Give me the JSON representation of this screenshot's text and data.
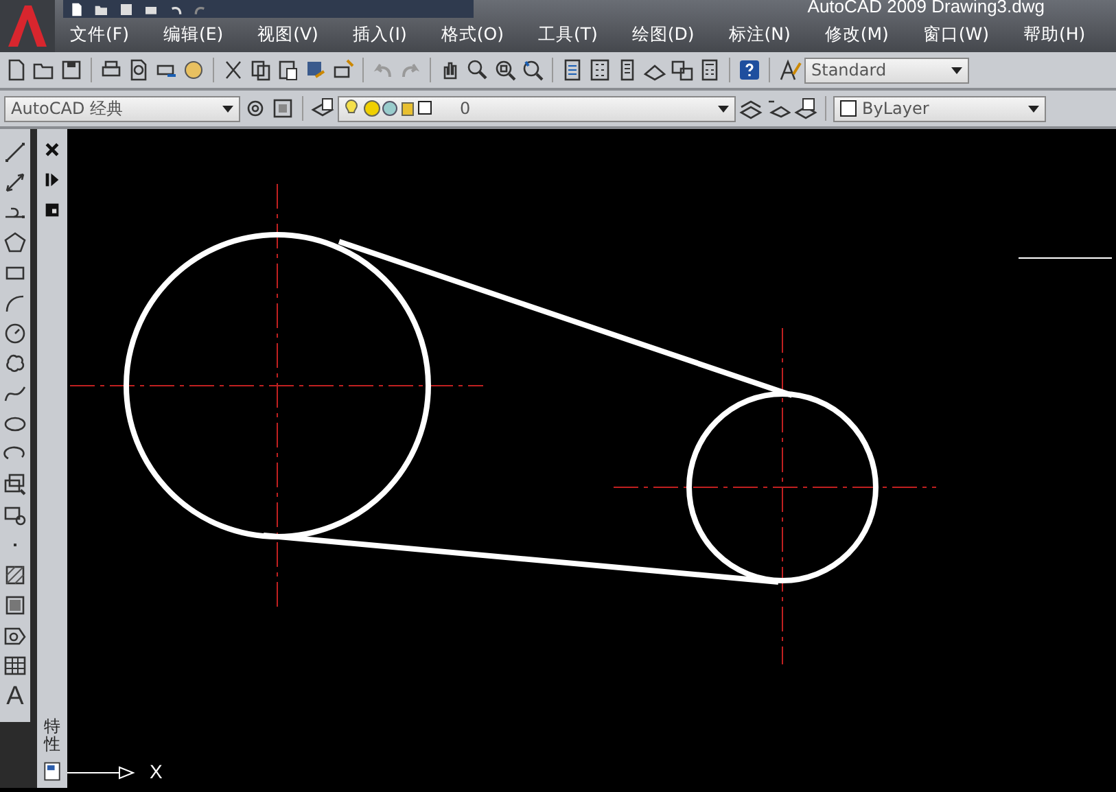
{
  "window": {
    "title": "AutoCAD 2009 Drawing3.dwg"
  },
  "menus": [
    {
      "label": "文件(F)"
    },
    {
      "label": "编辑(E)"
    },
    {
      "label": "视图(V)"
    },
    {
      "label": "插入(I)"
    },
    {
      "label": "格式(O)"
    },
    {
      "label": "工具(T)"
    },
    {
      "label": "绘图(D)"
    },
    {
      "label": "标注(N)"
    },
    {
      "label": "修改(M)"
    },
    {
      "label": "窗口(W)"
    },
    {
      "label": "帮助(H)"
    }
  ],
  "style_combo": {
    "value": "Standard"
  },
  "workspace_combo": {
    "value": "AutoCAD 经典"
  },
  "layer_combo": {
    "value": "0"
  },
  "color_combo": {
    "value": "ByLayer"
  },
  "draw_toolbar": {
    "text_tool": "A"
  },
  "properties_palette": {
    "title": "特性"
  },
  "ucs": {
    "x_label": "X"
  }
}
